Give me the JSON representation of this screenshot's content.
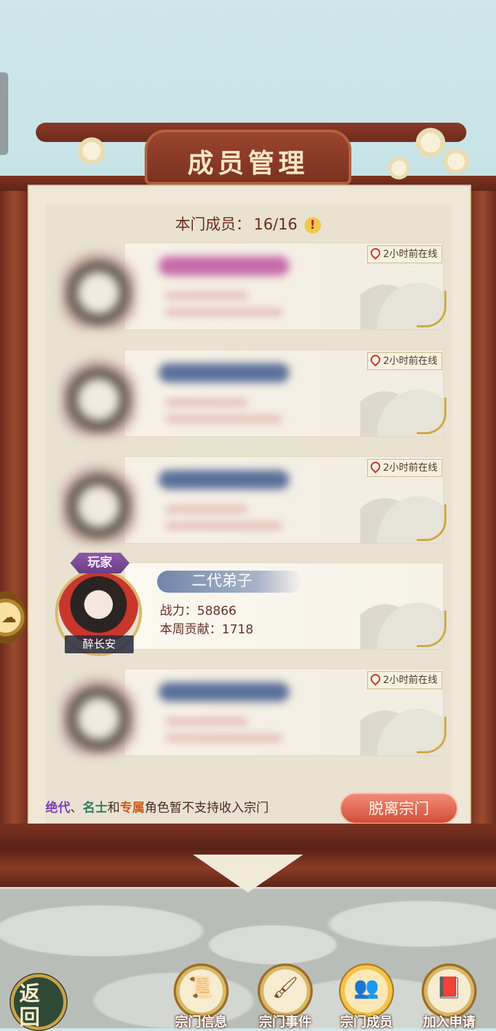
{
  "header": {
    "title": "成员管理"
  },
  "members": {
    "count_label": "本门成员：",
    "count_value": "16/16",
    "alert_icon": "!"
  },
  "cards": [
    {
      "online": "2小时前在线",
      "name_color": "#c66aa8"
    },
    {
      "online": "2小时前在线",
      "name_color": "#5a6f9a"
    },
    {
      "online": "2小时前在线",
      "name_color": "#5a6f9a"
    },
    {
      "online": "",
      "name_color": ""
    },
    {
      "online": "2小时前在线",
      "name_color": "#5a6f9a"
    }
  ],
  "player": {
    "badge": "玩家",
    "name": "醉长安",
    "rank": "二代弟子",
    "power_label": "战力：",
    "power_value": "58866",
    "contrib_label": "本周贡献：",
    "contrib_value": "1718"
  },
  "notice": {
    "tier1": "绝代",
    "sep": "、",
    "tier2": "名士",
    "and": "和",
    "tier3": "专属",
    "rest": "角色暂不支持收入宗门"
  },
  "actions": {
    "leave": "脱离宗门"
  },
  "nav": {
    "back": "返回",
    "items": [
      {
        "label": "宗门信息",
        "icon": "scroll-icon"
      },
      {
        "label": "宗门事件",
        "icon": "brush-icon"
      },
      {
        "label": "宗门成员",
        "icon": "members-icon"
      },
      {
        "label": "加入申请",
        "icon": "book-icon"
      }
    ]
  },
  "colors": {
    "accent": "#d24d39",
    "frame": "#7a311f",
    "paper": "#efe8d8"
  }
}
